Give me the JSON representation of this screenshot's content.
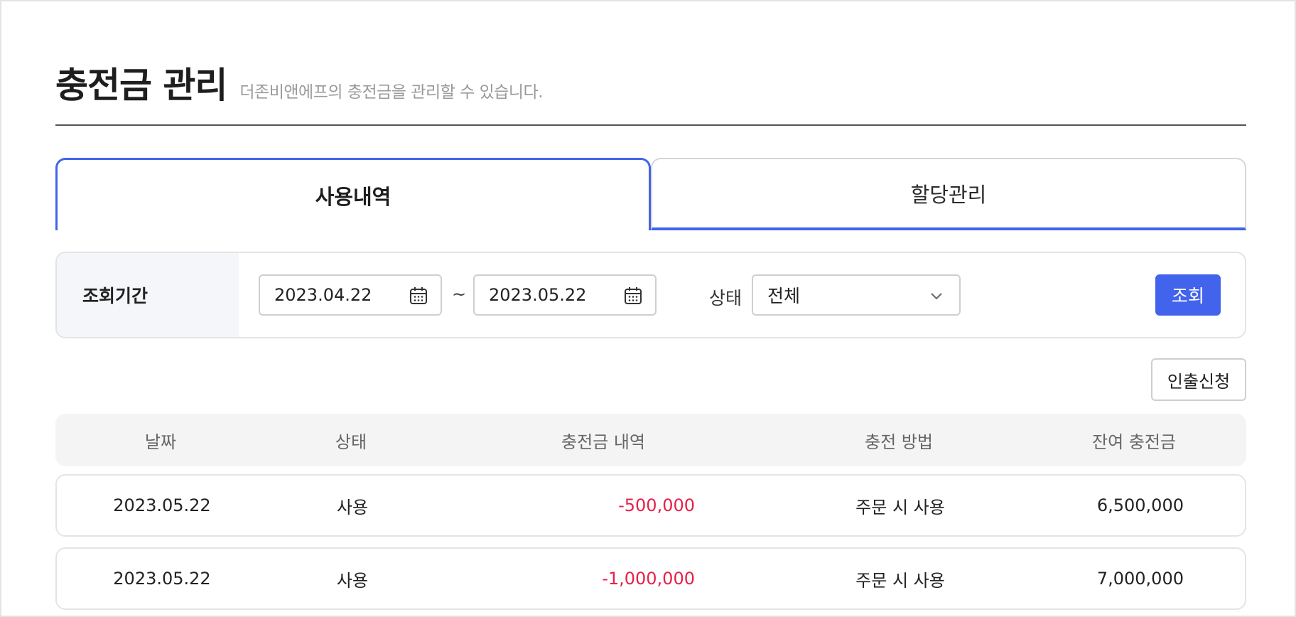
{
  "header": {
    "title": "충전금 관리",
    "subtitle": "더존비앤에프의 충전금을 관리할 수 있습니다."
  },
  "tabs": [
    {
      "label": "사용내역",
      "active": true
    },
    {
      "label": "할당관리",
      "active": false
    }
  ],
  "filter": {
    "period_label": "조회기간",
    "start_date": "2023.04.22",
    "separator": "~",
    "end_date": "2023.05.22",
    "status_label": "상태",
    "status_value": "전체",
    "search_label": "조회"
  },
  "actions": {
    "withdraw_label": "인출신청"
  },
  "table": {
    "columns": [
      "날짜",
      "상태",
      "충전금 내역",
      "충전 방법",
      "잔여 충전금"
    ],
    "rows": [
      {
        "date": "2023.05.22",
        "status": "사용",
        "amount": "-500,000",
        "method": "주문 시 사용",
        "balance": "6,500,000"
      },
      {
        "date": "2023.05.22",
        "status": "사용",
        "amount": "-1,000,000",
        "method": "주문 시 사용",
        "balance": "7,000,000"
      }
    ]
  },
  "colors": {
    "accent": "#4263eb",
    "negative": "#e8204a"
  }
}
